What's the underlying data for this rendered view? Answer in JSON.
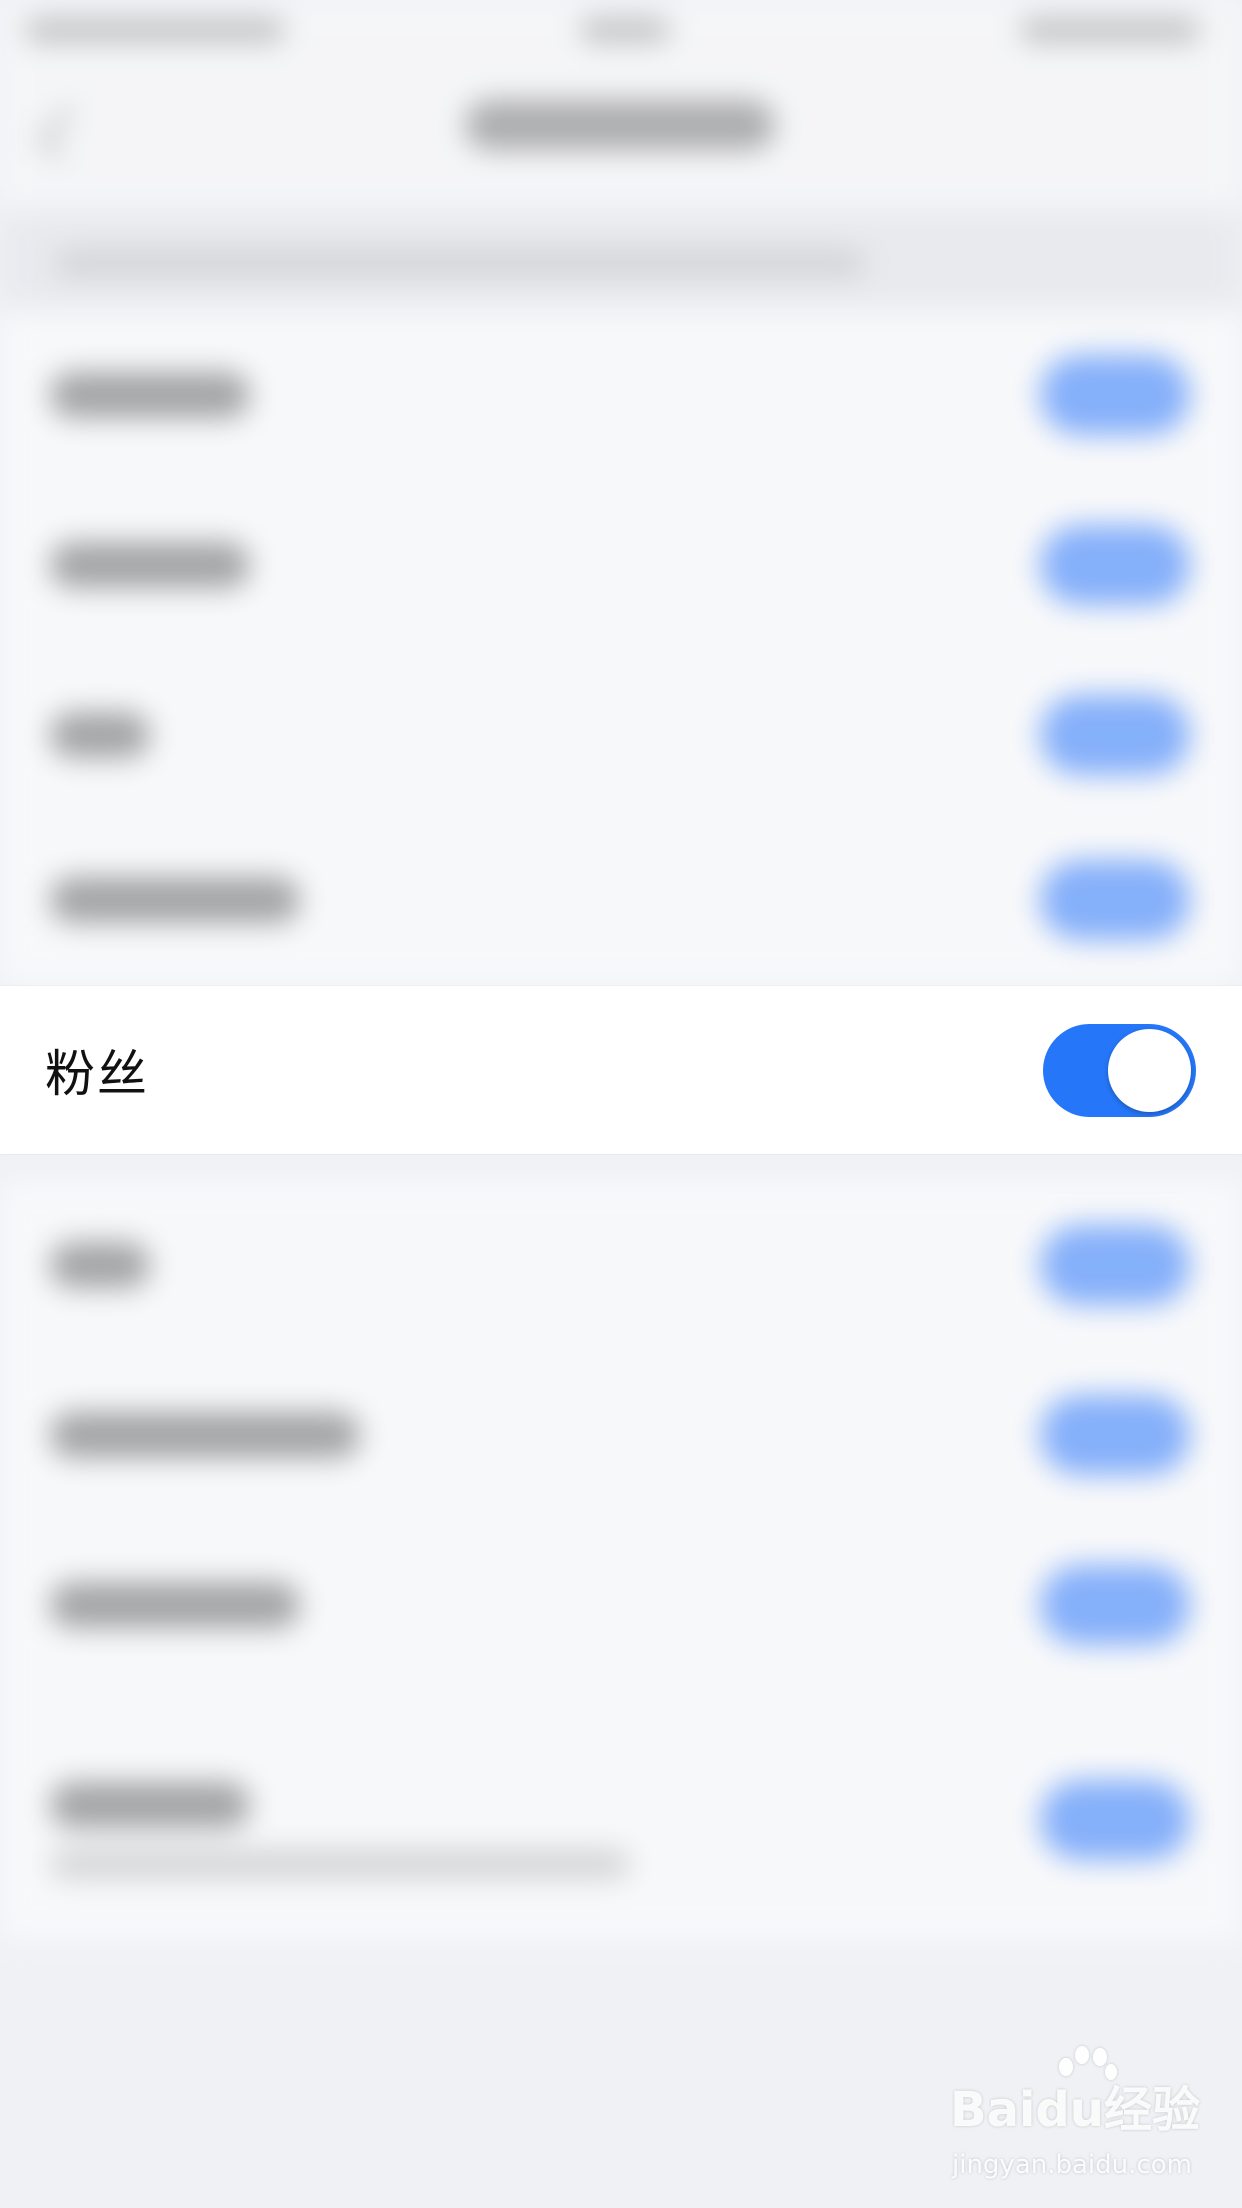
{
  "focused_row": {
    "label": "粉丝",
    "toggle_on": true,
    "toggle_color": "#2576f8"
  },
  "watermark": {
    "logo": "Baidu经验",
    "url": "jingyan.baidu.com"
  },
  "colors": {
    "background": "#eff1f5",
    "row_background": "#ffffff",
    "accent": "#2576f8"
  }
}
